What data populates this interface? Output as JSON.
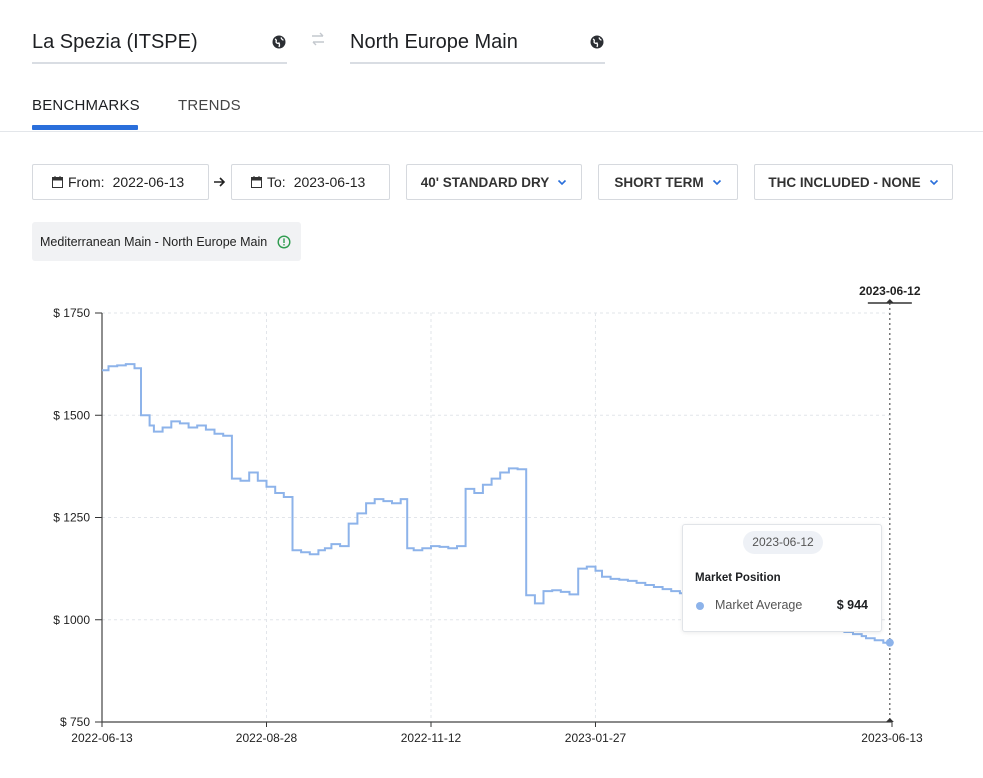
{
  "route": {
    "origin": "La Spezia (ITSPE)",
    "destination": "North Europe Main"
  },
  "tabs": [
    {
      "label": "BENCHMARKS",
      "active": true
    },
    {
      "label": "TRENDS",
      "active": false
    }
  ],
  "filters": {
    "from_label": "From:",
    "from_value": "2022-06-13",
    "to_label": "To:",
    "to_value": "2023-06-13",
    "container": "40' STANDARD DRY",
    "term": "SHORT TERM",
    "thc": "THC INCLUDED - NONE"
  },
  "route_chip": "Mediterranean Main - North Europe Main",
  "colors": {
    "accent": "#2a6fdb",
    "series": "#8db3ea",
    "info": "#2e9b4e"
  },
  "chart_data": {
    "type": "line",
    "step": true,
    "xlabel": "",
    "ylabel": "",
    "x_ticks": [
      "2022-06-13",
      "2022-08-28",
      "2022-11-12",
      "2023-01-27",
      "2023-06-13"
    ],
    "y_ticks": [
      "$ 1750",
      "$ 1500",
      "$ 1250",
      "$ 1000",
      "$ 750"
    ],
    "ylim": [
      750,
      1750
    ],
    "xlim": [
      "2022-06-13",
      "2023-06-13"
    ],
    "grid": true,
    "series": [
      {
        "name": "Market Average",
        "x": [
          "2022-06-13",
          "2022-06-16",
          "2022-06-20",
          "2022-06-24",
          "2022-06-28",
          "2022-07-01",
          "2022-07-05",
          "2022-07-07",
          "2022-07-11",
          "2022-07-15",
          "2022-07-19",
          "2022-07-23",
          "2022-07-27",
          "2022-07-31",
          "2022-08-04",
          "2022-08-08",
          "2022-08-12",
          "2022-08-16",
          "2022-08-20",
          "2022-08-24",
          "2022-08-28",
          "2022-09-01",
          "2022-09-05",
          "2022-09-09",
          "2022-09-13",
          "2022-09-17",
          "2022-09-21",
          "2022-09-24",
          "2022-09-27",
          "2022-10-01",
          "2022-10-05",
          "2022-10-09",
          "2022-10-13",
          "2022-10-17",
          "2022-10-21",
          "2022-10-25",
          "2022-10-29",
          "2022-11-01",
          "2022-11-04",
          "2022-11-08",
          "2022-11-12",
          "2022-11-16",
          "2022-11-20",
          "2022-11-24",
          "2022-11-28",
          "2022-12-02",
          "2022-12-06",
          "2022-12-10",
          "2022-12-14",
          "2022-12-18",
          "2022-12-22",
          "2022-12-26",
          "2022-12-30",
          "2023-01-03",
          "2023-01-07",
          "2023-01-11",
          "2023-01-15",
          "2023-01-19",
          "2023-01-23",
          "2023-01-27",
          "2023-01-30",
          "2023-02-03",
          "2023-02-07",
          "2023-02-11",
          "2023-02-15",
          "2023-02-19",
          "2023-02-23",
          "2023-02-27",
          "2023-03-03",
          "2023-03-07",
          "2023-03-11",
          "2023-03-15",
          "2023-03-19",
          "2023-03-23",
          "2023-03-27",
          "2023-03-31",
          "2023-04-04",
          "2023-04-08",
          "2023-04-12",
          "2023-04-16",
          "2023-04-20",
          "2023-04-24",
          "2023-04-28",
          "2023-05-02",
          "2023-05-06",
          "2023-05-10",
          "2023-05-14",
          "2023-05-18",
          "2023-05-22",
          "2023-05-26",
          "2023-05-30",
          "2023-06-01",
          "2023-06-05",
          "2023-06-09",
          "2023-06-12"
        ],
        "values": [
          1610,
          1620,
          1622,
          1625,
          1615,
          1500,
          1475,
          1460,
          1470,
          1485,
          1480,
          1470,
          1475,
          1465,
          1455,
          1450,
          1345,
          1340,
          1360,
          1340,
          1325,
          1310,
          1300,
          1170,
          1165,
          1160,
          1170,
          1175,
          1185,
          1180,
          1235,
          1260,
          1285,
          1295,
          1290,
          1285,
          1295,
          1175,
          1170,
          1175,
          1180,
          1178,
          1175,
          1180,
          1320,
          1310,
          1330,
          1345,
          1360,
          1370,
          1368,
          1060,
          1040,
          1070,
          1072,
          1068,
          1062,
          1125,
          1130,
          1120,
          1105,
          1100,
          1098,
          1095,
          1090,
          1085,
          1080,
          1075,
          1070,
          1065,
          1060,
          1055,
          1050,
          1045,
          1040,
          1035,
          1030,
          1025,
          1020,
          1015,
          1010,
          1005,
          1000,
          995,
          990,
          985,
          980,
          975,
          970,
          965,
          960,
          955,
          950,
          944,
          944
        ]
      }
    ],
    "highlight": {
      "date": "2023-06-12",
      "tooltip_title": "Market Position",
      "series": "Market Average",
      "value_label": "$ 944"
    }
  }
}
